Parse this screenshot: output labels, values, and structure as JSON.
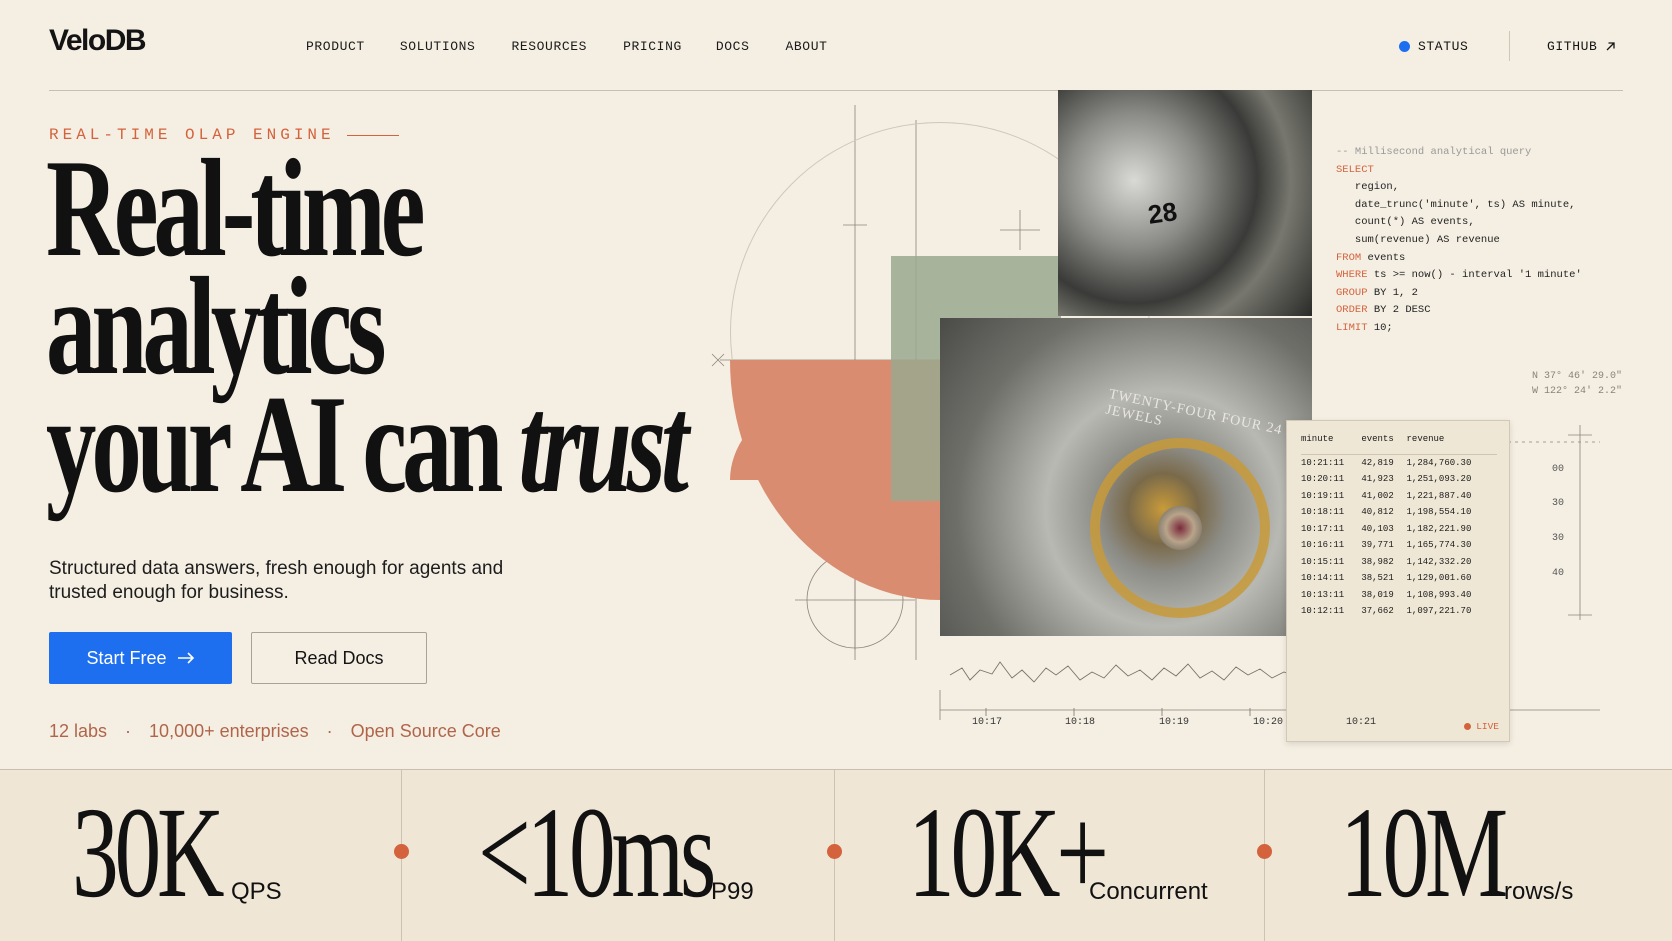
{
  "brand": {
    "logo_text": "VeloDB"
  },
  "nav": {
    "items": [
      "PRODUCT",
      "SOLUTIONS",
      "RESOURCES",
      "PRICING",
      "DOCS",
      "ABOUT"
    ],
    "status_label": "STATUS",
    "github_label": "GITHUB",
    "github_icon": "arrow-up-right-icon",
    "status_dot_color": "#1e6ff0"
  },
  "hero": {
    "eyebrow": "REAL-TIME OLAP ENGINE",
    "headline_line1": "Real-time",
    "headline_line2": "analytics",
    "headline_line3_plain": "your AI can",
    "headline_line3_italic": "trust",
    "subtitle": "Structured data answers, fresh enough for agents and trusted enough for business.",
    "primary_cta": "Start Free",
    "primary_cta_icon": "arrow-right-icon",
    "secondary_cta": "Read Docs",
    "meta": [
      "12 labs",
      "10,000+ enterprises",
      "Open Source Core"
    ],
    "accent_color": "#d4623d",
    "cta_color": "#1e6ff0"
  },
  "sql": {
    "comment": "-- Millisecond analytical query",
    "lines": [
      {
        "k": "SELECT",
        "t": ""
      },
      {
        "k": "",
        "t": "   region,"
      },
      {
        "k": "",
        "t": "   date_trunc('minute', ts) AS minute,"
      },
      {
        "k": "",
        "t": "   count(*) AS events,"
      },
      {
        "k": "",
        "t": "   sum(revenue) AS revenue"
      },
      {
        "k": "FROM",
        "t": " events"
      },
      {
        "k": "WHERE",
        "t": " ts >= now() - interval '1 minute'"
      },
      {
        "k": "GROUP",
        "t": " BY 1, 2"
      },
      {
        "k": "ORDER",
        "t": " BY 2 DESC"
      },
      {
        "k": "LIMIT",
        "t": " 10;"
      }
    ]
  },
  "results_table": {
    "columns": [
      "minute",
      "events",
      "revenue"
    ],
    "rows": [
      [
        "10:21:11",
        "42,819",
        "1,284,760.30"
      ],
      [
        "10:20:11",
        "41,923",
        "1,251,093.20"
      ],
      [
        "10:19:11",
        "41,002",
        "1,221,887.40"
      ],
      [
        "10:18:11",
        "40,812",
        "1,198,554.10"
      ],
      [
        "10:17:11",
        "40,103",
        "1,182,221.90"
      ],
      [
        "10:16:11",
        "39,771",
        "1,165,774.30"
      ],
      [
        "10:15:11",
        "38,982",
        "1,142,332.20"
      ],
      [
        "10:14:11",
        "38,521",
        "1,129,001.60"
      ],
      [
        "10:13:11",
        "38,019",
        "1,108,993.40"
      ],
      [
        "10:12:11",
        "37,662",
        "1,097,221.70"
      ]
    ],
    "live_label": "LIVE"
  },
  "coords": {
    "lat": "N 37° 46' 29.0\"",
    "lon": "W 122° 24' 2.2\""
  },
  "ruler_ticks": [
    "00",
    "30",
    "30",
    "40"
  ],
  "time_axis": [
    "10:17",
    "10:18",
    "10:19",
    "10:20",
    "10:21"
  ],
  "photo": {
    "dial_number": "28",
    "engraving": "TWENTY-FOUR FOUR 24 JEWELS"
  },
  "stats": [
    {
      "value": "30K",
      "unit": "QPS"
    },
    {
      "value": "<10ms",
      "unit": "P99"
    },
    {
      "value": "10K+",
      "unit": "Concurrent"
    },
    {
      "value": "10M",
      "unit": "rows/s"
    }
  ]
}
